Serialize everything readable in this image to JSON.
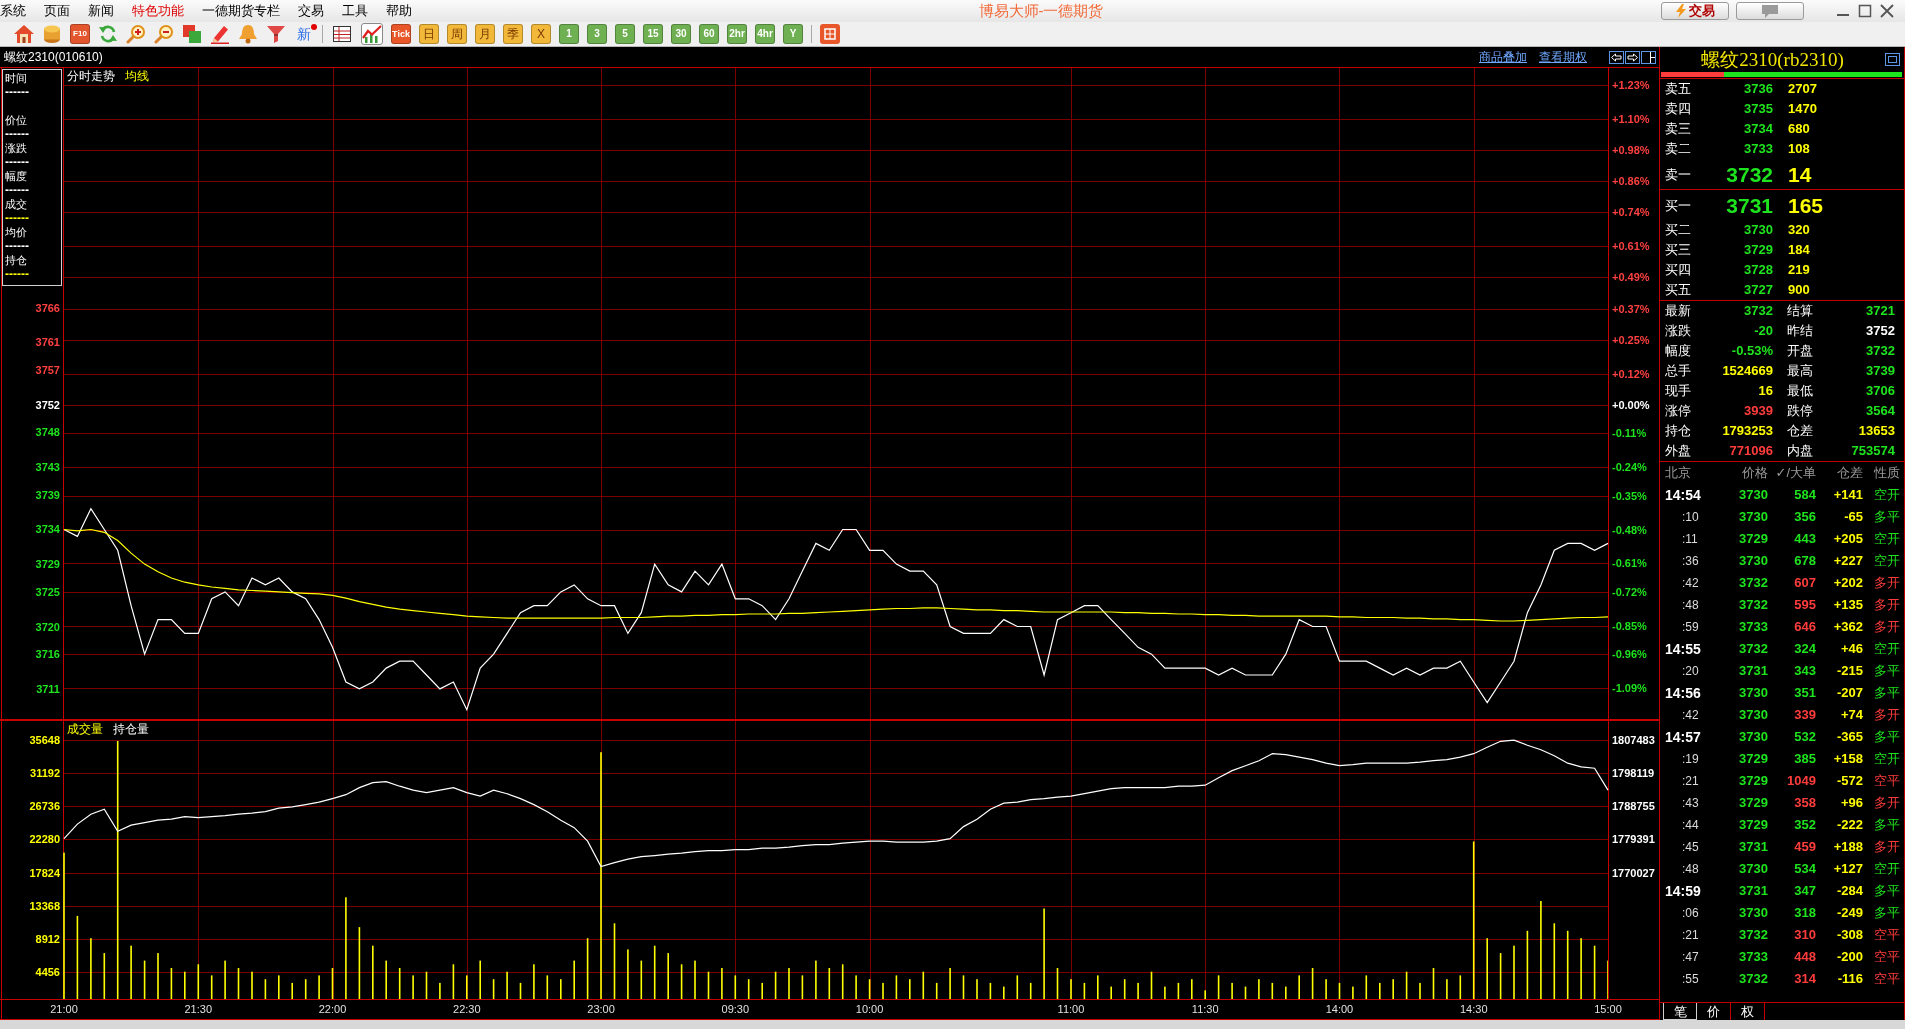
{
  "menu": [
    {
      "label": "系统",
      "emphasized": false
    },
    {
      "label": "页面",
      "emphasized": false
    },
    {
      "label": "新闻",
      "emphasized": false
    },
    {
      "label": "特色功能",
      "emphasized": true
    },
    {
      "label": "一德期货专栏",
      "emphasized": false
    },
    {
      "label": "交易",
      "emphasized": false
    },
    {
      "label": "工具",
      "emphasized": false
    },
    {
      "label": "帮助",
      "emphasized": false
    }
  ],
  "title": "博易大师-一德期货",
  "title_buttons": [
    {
      "kind": "trade",
      "label": "交易"
    },
    {
      "kind": "chat"
    }
  ],
  "tools": [
    {
      "kind": "home"
    },
    {
      "kind": "coins"
    },
    {
      "kind": "f10",
      "label": "F10"
    },
    {
      "kind": "refresh"
    },
    {
      "kind": "zoomin"
    },
    {
      "kind": "zoomout"
    },
    {
      "kind": "squares"
    },
    {
      "kind": "pencil"
    },
    {
      "kind": "bell"
    },
    {
      "kind": "filter"
    },
    {
      "kind": "news",
      "label": "新"
    }
  ],
  "views": [
    {
      "kind": "table",
      "selected": false
    },
    {
      "kind": "trend",
      "selected": true
    },
    {
      "kind": "tick",
      "label": "Tick",
      "selected": false
    },
    {
      "kind": "calendar",
      "label": "日",
      "selected": false
    },
    {
      "kind": "calendar",
      "label": "周",
      "selected": false
    },
    {
      "kind": "calendar",
      "label": "月",
      "selected": false
    },
    {
      "kind": "calendar",
      "label": "季",
      "selected": false
    },
    {
      "kind": "calendar",
      "label": "X",
      "selected": false
    },
    {
      "kind": "minute",
      "label": "1",
      "selected": false
    },
    {
      "kind": "minute",
      "label": "3",
      "selected": false
    },
    {
      "kind": "minute",
      "label": "5",
      "selected": false
    },
    {
      "kind": "minute",
      "label": "15",
      "selected": false
    },
    {
      "kind": "minute",
      "label": "30",
      "selected": false
    },
    {
      "kind": "minute",
      "label": "60",
      "selected": false
    },
    {
      "kind": "minute",
      "label": "2hr",
      "selected": false
    },
    {
      "kind": "minute",
      "label": "4hr",
      "selected": false
    },
    {
      "kind": "minute",
      "label": "Y",
      "selected": false
    }
  ],
  "chart_header": {
    "code": "螺纹2310(010610)",
    "links": [
      "商品叠加",
      "查看期权"
    ]
  },
  "info_box": [
    {
      "label": "时间",
      "value": "------",
      "color": "#ffffff"
    },
    {
      "label": "价位",
      "value": "------",
      "color": "#ffffff"
    },
    {
      "label": "涨跌",
      "value": "------",
      "color": "#ffffff"
    },
    {
      "label": "幅度",
      "value": "------",
      "color": "#ffffff"
    },
    {
      "label": "成交",
      "value": "------",
      "color": "#ffff00"
    },
    {
      "label": "均价",
      "value": "------",
      "color": "#ffffff"
    },
    {
      "label": "持仓",
      "value": "------",
      "color": "#ffff00"
    }
  ],
  "price_chart": {
    "chart_data": {
      "type": "line",
      "grid": true,
      "ylim": [
        3706.51,
        3800.74
      ],
      "yticks": [
        3766,
        3761,
        3757,
        3752,
        3748,
        3743,
        3739,
        3734,
        3729,
        3725,
        3720,
        3716,
        3711
      ],
      "y2lim": [
        -1.2124,
        1.299
      ],
      "y2ticks": [
        {
          "value": 1.23,
          "label": "+1.23%"
        },
        {
          "value": 1.1,
          "label": "+1.10%"
        },
        {
          "value": 0.98,
          "label": "+0.98%"
        },
        {
          "value": 0.86,
          "label": "+0.86%"
        },
        {
          "value": 0.74,
          "label": "+0.74%"
        },
        {
          "value": 0.61,
          "label": "+0.61%"
        },
        {
          "value": 0.49,
          "label": "+0.49%"
        },
        {
          "value": 0.37,
          "label": "+0.37%"
        },
        {
          "value": 0.25,
          "label": "+0.25%"
        },
        {
          "value": 0.12,
          "label": "+0.12%"
        },
        {
          "value": 0,
          "label": "+0.00%"
        },
        {
          "value": -0.11,
          "label": "-0.11%"
        },
        {
          "value": -0.24,
          "label": "-0.24%"
        },
        {
          "value": -0.35,
          "label": "-0.35%"
        },
        {
          "value": -0.48,
          "label": "-0.48%"
        },
        {
          "value": -0.61,
          "label": "-0.61%"
        },
        {
          "value": -0.72,
          "label": "-0.72%"
        },
        {
          "value": -0.85,
          "label": "-0.85%"
        },
        {
          "value": -0.96,
          "label": "-0.96%"
        },
        {
          "value": -1.09,
          "label": "-1.09%"
        }
      ],
      "categories": [
        null,
        null,
        null,
        null,
        null,
        null,
        null,
        null,
        null,
        null,
        null,
        null,
        null,
        null,
        null,
        null,
        null,
        null,
        null,
        null,
        null,
        null,
        null,
        null,
        null,
        null,
        null,
        null,
        null,
        null,
        null,
        null,
        null,
        null,
        null,
        null,
        null,
        null,
        null,
        null,
        null,
        null,
        null,
        null,
        null,
        null,
        null,
        null,
        null,
        null,
        null,
        null,
        null,
        null,
        null,
        null,
        null,
        null,
        null,
        null,
        null,
        null,
        null,
        null,
        null,
        null,
        null,
        null,
        null,
        null,
        null,
        null,
        null,
        null,
        null,
        null,
        null,
        null,
        null,
        null,
        null,
        null,
        null,
        null,
        null,
        null,
        null,
        null,
        null,
        null,
        null,
        null,
        null,
        null,
        null,
        null,
        null,
        null,
        null,
        null,
        null,
        null,
        null,
        null,
        null,
        null,
        null,
        null,
        null,
        null,
        null,
        null,
        null,
        null,
        null,
        null
      ],
      "series": [
        {
          "name": "分时走势",
          "color": "#ffffff",
          "values": [
            3734,
            3733,
            3737,
            3734,
            3731,
            3723,
            3716,
            3721,
            3721,
            3719,
            3719,
            3724,
            3725,
            3723,
            3727,
            3726,
            3727,
            3725,
            3724,
            3721,
            3717,
            3712,
            3711,
            3712,
            3714,
            3715,
            3715,
            3713,
            3711,
            3712,
            3708,
            3714,
            3716,
            3719,
            3722,
            3723,
            3723,
            3725,
            3726,
            3724,
            3723,
            3723,
            3719,
            3722,
            3729,
            3726,
            3725,
            3728,
            3726,
            3729,
            3724,
            3724,
            3723,
            3721,
            3724,
            3728,
            3732,
            3731,
            3734,
            3734,
            3731,
            3731,
            3729,
            3728,
            3728,
            3726,
            3720,
            3719,
            3719,
            3719,
            3721,
            3720,
            3720,
            3713,
            3721,
            3722,
            3723,
            3723,
            3721,
            3719,
            3717,
            3716,
            3714,
            3714,
            3714,
            3714,
            3713,
            3714,
            3713,
            3713,
            3713,
            3716,
            3721,
            3720,
            3720,
            3715,
            3715,
            3715,
            3714,
            3713,
            3714,
            3713,
            3714,
            3714,
            3715,
            3712,
            3709,
            3712,
            3715,
            3722,
            3726,
            3731,
            3732,
            3732,
            3731,
            3732
          ]
        },
        {
          "name": "均线",
          "color": "#ffff00",
          "values": [
            3734,
            3733.8,
            3734,
            3733.6,
            3732.4,
            3730.6,
            3729,
            3727.9,
            3727,
            3726.4,
            3726,
            3725.7,
            3725.5,
            3725.3,
            3725.2,
            3725.1,
            3725,
            3724.9,
            3724.8,
            3724.7,
            3724.5,
            3724.1,
            3723.6,
            3723.2,
            3722.8,
            3722.5,
            3722.3,
            3722.1,
            3721.9,
            3721.7,
            3721.5,
            3721.4,
            3721.3,
            3721.2,
            3721.2,
            3721.2,
            3721.2,
            3721.2,
            3721.2,
            3721.2,
            3721.2,
            3721.3,
            3721.3,
            3721.3,
            3721.4,
            3721.5,
            3721.5,
            3721.6,
            3721.6,
            3721.7,
            3721.7,
            3721.8,
            3721.8,
            3721.8,
            3721.9,
            3721.9,
            3722,
            3722.1,
            3722.2,
            3722.3,
            3722.4,
            3722.5,
            3722.6,
            3722.6,
            3722.7,
            3722.7,
            3722.6,
            3722.5,
            3722.4,
            3722.4,
            3722.3,
            3722.3,
            3722.2,
            3722.1,
            3722.1,
            3722.1,
            3722.1,
            3722.1,
            3722.1,
            3722,
            3722,
            3721.9,
            3721.9,
            3721.8,
            3721.8,
            3721.7,
            3721.7,
            3721.6,
            3721.6,
            3721.5,
            3721.5,
            3721.5,
            3721.5,
            3721.5,
            3721.5,
            3721.4,
            3721.4,
            3721.3,
            3721.3,
            3721.3,
            3721.2,
            3721.2,
            3721.1,
            3721.1,
            3721,
            3721,
            3720.9,
            3720.8,
            3720.8,
            3720.9,
            3721,
            3721.1,
            3721.2,
            3721.3,
            3721.3,
            3721.4
          ]
        }
      ]
    }
  },
  "volume_chart": {
    "chart_data": {
      "type": "bar",
      "grid": true,
      "ylim": [
        700,
        38320
      ],
      "yticks": [
        35648,
        31192,
        26736,
        22280,
        17824,
        13368,
        8912,
        4456
      ],
      "categories": [
        "21:00",
        null,
        null,
        null,
        null,
        null,
        null,
        null,
        null,
        null,
        "21:30",
        null,
        null,
        null,
        null,
        null,
        null,
        null,
        null,
        null,
        "22:00",
        null,
        null,
        null,
        null,
        null,
        null,
        null,
        null,
        null,
        "22:30",
        null,
        null,
        null,
        null,
        null,
        null,
        null,
        null,
        null,
        "23:00",
        null,
        null,
        null,
        null,
        null,
        null,
        null,
        null,
        null,
        "09:30",
        null,
        null,
        null,
        null,
        null,
        null,
        null,
        null,
        null,
        "10:00",
        null,
        null,
        null,
        null,
        null,
        null,
        null,
        null,
        null,
        null,
        null,
        null,
        null,
        null,
        "11:00",
        null,
        null,
        null,
        null,
        null,
        null,
        null,
        null,
        null,
        "11:30",
        null,
        null,
        null,
        null,
        null,
        null,
        null,
        null,
        null,
        "14:00",
        null,
        null,
        null,
        null,
        null,
        null,
        null,
        null,
        null,
        "14:30",
        null,
        null,
        null,
        null,
        null,
        null,
        null,
        null,
        null,
        "15:00"
      ],
      "series": [
        {
          "name": "成交量",
          "color": "#ffff00",
          "values": [
            20500,
            12000,
            9000,
            7000,
            35500,
            8000,
            6000,
            7000,
            5000,
            4500,
            5500,
            4000,
            6000,
            5000,
            4500,
            3500,
            4000,
            3000,
            3500,
            4000,
            5000,
            14500,
            10500,
            8000,
            6000,
            5000,
            4000,
            4500,
            3000,
            5500,
            4000,
            6000,
            3500,
            4500,
            3000,
            5500,
            4000,
            3500,
            6000,
            9000,
            34000,
            11000,
            7500,
            6000,
            8000,
            7000,
            5500,
            6000,
            4500,
            5000,
            4000,
            3500,
            3000,
            4500,
            5000,
            4000,
            6000,
            5000,
            5500,
            4000,
            3500,
            3000,
            4000,
            3500,
            4500,
            3000,
            5000,
            4000,
            3500,
            3000,
            2500,
            4000,
            3000,
            13000,
            5000,
            3500,
            3000,
            4000,
            2500,
            3500,
            3000,
            4500,
            2500,
            3000,
            3500,
            2000,
            4000,
            3000,
            2500,
            3500,
            3000,
            2500,
            4000,
            5000,
            3500,
            3000,
            2500,
            4000,
            3000,
            3500,
            4500,
            3000,
            5000,
            3500,
            4000,
            22000,
            9000,
            7000,
            8000,
            10000,
            14000,
            11000,
            10000,
            9000,
            8000,
            6000
          ]
        }
      ]
    }
  },
  "open_interest_chart": {
    "chart_data": {
      "type": "line",
      "ylim": [
        1734033,
        1813103
      ],
      "yticks": [
        1807483,
        1798119,
        1788755,
        1779391,
        1770027
      ],
      "categories": [
        null,
        null,
        null,
        null,
        null,
        null,
        null,
        null,
        null,
        null,
        null,
        null,
        null,
        null,
        null,
        null,
        null,
        null,
        null,
        null,
        null,
        null,
        null,
        null,
        null,
        null,
        null,
        null,
        null,
        null,
        null,
        null,
        null,
        null,
        null,
        null,
        null,
        null,
        null,
        null,
        null,
        null,
        null,
        null,
        null,
        null,
        null,
        null,
        null,
        null,
        null,
        null,
        null,
        null,
        null,
        null,
        null,
        null,
        null,
        null,
        null,
        null,
        null,
        null,
        null,
        null,
        null,
        null,
        null,
        null,
        null,
        null,
        null,
        null,
        null,
        null,
        null,
        null,
        null,
        null,
        null,
        null,
        null,
        null,
        null,
        null,
        null,
        null,
        null,
        null,
        null,
        null,
        null,
        null,
        null,
        null,
        null,
        null,
        null,
        null,
        null,
        null,
        null,
        null,
        null,
        null,
        null,
        null,
        null,
        null,
        null,
        null,
        null,
        null,
        null,
        null
      ],
      "series": [
        {
          "name": "持仓量",
          "color": "#ffffff",
          "values": [
            1779600,
            1783700,
            1786500,
            1787900,
            1781700,
            1783400,
            1784100,
            1784800,
            1785100,
            1785800,
            1785500,
            1785800,
            1786100,
            1786500,
            1786800,
            1787200,
            1788200,
            1788600,
            1789200,
            1789900,
            1790900,
            1792000,
            1794000,
            1795400,
            1795700,
            1794400,
            1793300,
            1792600,
            1793300,
            1794000,
            1792600,
            1791600,
            1793300,
            1792300,
            1790900,
            1789200,
            1787200,
            1784800,
            1782700,
            1778900,
            1771700,
            1772800,
            1773800,
            1774500,
            1774800,
            1775200,
            1775500,
            1775900,
            1776200,
            1776200,
            1776500,
            1776500,
            1776900,
            1776900,
            1777200,
            1777600,
            1777900,
            1777900,
            1778300,
            1778600,
            1778900,
            1778900,
            1778600,
            1778600,
            1778600,
            1778900,
            1779600,
            1783000,
            1785100,
            1787900,
            1789600,
            1789900,
            1790600,
            1790900,
            1791300,
            1791600,
            1792300,
            1793000,
            1793700,
            1794000,
            1794000,
            1794000,
            1794000,
            1794400,
            1794400,
            1794700,
            1796800,
            1798800,
            1800200,
            1801600,
            1803600,
            1803300,
            1802600,
            1801900,
            1800900,
            1800200,
            1800500,
            1800900,
            1800900,
            1800900,
            1800900,
            1801200,
            1801600,
            1801900,
            1802600,
            1803600,
            1805400,
            1807100,
            1807400,
            1806000,
            1804700,
            1803000,
            1800900,
            1799900,
            1799500,
            1793300
          ]
        }
      ]
    }
  },
  "quote": {
    "title": "螺纹2310(rb2310)",
    "ratio_bar": {
      "level": 0.26
    },
    "asks": [
      {
        "label": "卖五",
        "price": "3736",
        "volume": "2707",
        "kind": "level"
      },
      {
        "label": "卖四",
        "price": "3735",
        "volume": "1470",
        "kind": "level"
      },
      {
        "label": "卖三",
        "price": "3734",
        "volume": "680",
        "kind": "level"
      },
      {
        "label": "卖二",
        "price": "3733",
        "volume": "108",
        "kind": "level"
      },
      {
        "label": "卖一",
        "price": "3732",
        "volume": "14",
        "kind": "best"
      }
    ],
    "bids": [
      {
        "label": "买一",
        "price": "3731",
        "volume": "165",
        "kind": "best"
      },
      {
        "label": "买二",
        "price": "3730",
        "volume": "320",
        "kind": "level"
      },
      {
        "label": "买三",
        "price": "3729",
        "volume": "184",
        "kind": "level"
      },
      {
        "label": "买四",
        "price": "3728",
        "volume": "219",
        "kind": "level"
      },
      {
        "label": "买五",
        "price": "3727",
        "volume": "900",
        "kind": "level"
      }
    ],
    "stats": [
      {
        "label": "最新",
        "value": "3732",
        "color": "#1ee41e"
      },
      {
        "label": "结算",
        "value": "3721",
        "color": "#1ee41e"
      },
      {
        "label": "涨跌",
        "value": "-20",
        "color": "#1ee41e"
      },
      {
        "label": "昨结",
        "value": "3752",
        "color": "#ffffff"
      },
      {
        "label": "幅度",
        "value": "-0.53%",
        "color": "#1ee41e"
      },
      {
        "label": "开盘",
        "value": "3732",
        "color": "#1ee41e"
      },
      {
        "label": "总手",
        "value": "1524669",
        "color": "#ffff00"
      },
      {
        "label": "最高",
        "value": "3739",
        "color": "#1ee41e"
      },
      {
        "label": "现手",
        "value": "16",
        "color": "#ffff00"
      },
      {
        "label": "最低",
        "value": "3706",
        "color": "#1ee41e"
      },
      {
        "label": "涨停",
        "value": "3939",
        "color": "#ff3c3c"
      },
      {
        "label": "跌停",
        "value": "3564",
        "color": "#1ee41e"
      },
      {
        "label": "持仓",
        "value": "1793253",
        "color": "#ffff00"
      },
      {
        "label": "仓差",
        "value": "13653",
        "color": "#ffff00"
      },
      {
        "label": "外盘",
        "value": "771096",
        "color": "#ff3c3c"
      },
      {
        "label": "内盘",
        "value": "753574",
        "color": "#1ee41e"
      }
    ]
  },
  "trades": {
    "columns": [
      "北京",
      "价格",
      "✓/大单",
      "仓差",
      "性质"
    ],
    "rows": [
      {
        "time": "14:54",
        "kind": "minute",
        "price": "3730",
        "volume": "584",
        "oi_change": "+141",
        "nature": "空开",
        "color": "#1ee41e"
      },
      {
        "time": ":10",
        "kind": "second",
        "price": "3730",
        "volume": "356",
        "oi_change": "-65",
        "nature": "多平",
        "color": "#1ee41e"
      },
      {
        "time": ":11",
        "kind": "second",
        "price": "3729",
        "volume": "443",
        "oi_change": "+205",
        "nature": "空开",
        "color": "#1ee41e"
      },
      {
        "time": ":36",
        "kind": "second",
        "price": "3730",
        "volume": "678",
        "oi_change": "+227",
        "nature": "空开",
        "color": "#1ee41e"
      },
      {
        "time": ":42",
        "kind": "second",
        "price": "3732",
        "volume": "607",
        "oi_change": "+202",
        "nature": "多开",
        "color": "#ff3c3c"
      },
      {
        "time": ":48",
        "kind": "second",
        "price": "3732",
        "volume": "595",
        "oi_change": "+135",
        "nature": "多开",
        "color": "#ff3c3c"
      },
      {
        "time": ":59",
        "kind": "second",
        "price": "3733",
        "volume": "646",
        "oi_change": "+362",
        "nature": "多开",
        "color": "#ff3c3c"
      },
      {
        "time": "14:55",
        "kind": "minute",
        "price": "3732",
        "volume": "324",
        "oi_change": "+46",
        "nature": "空开",
        "color": "#1ee41e"
      },
      {
        "time": ":20",
        "kind": "second",
        "price": "3731",
        "volume": "343",
        "oi_change": "-215",
        "nature": "多平",
        "color": "#1ee41e"
      },
      {
        "time": "14:56",
        "kind": "minute",
        "price": "3730",
        "volume": "351",
        "oi_change": "-207",
        "nature": "多平",
        "color": "#1ee41e"
      },
      {
        "time": ":42",
        "kind": "second",
        "price": "3730",
        "volume": "339",
        "oi_change": "+74",
        "nature": "多开",
        "color": "#ff3c3c"
      },
      {
        "time": "14:57",
        "kind": "minute",
        "price": "3730",
        "volume": "532",
        "oi_change": "-365",
        "nature": "多平",
        "color": "#1ee41e"
      },
      {
        "time": ":19",
        "kind": "second",
        "price": "3729",
        "volume": "385",
        "oi_change": "+158",
        "nature": "空开",
        "color": "#1ee41e"
      },
      {
        "time": ":21",
        "kind": "second",
        "price": "3729",
        "volume": "1049",
        "oi_change": "-572",
        "nature": "空平",
        "color": "#ff3c3c"
      },
      {
        "time": ":43",
        "kind": "second",
        "price": "3729",
        "volume": "358",
        "oi_change": "+96",
        "nature": "多开",
        "color": "#ff3c3c"
      },
      {
        "time": ":44",
        "kind": "second",
        "price": "3729",
        "volume": "352",
        "oi_change": "-222",
        "nature": "多平",
        "color": "#1ee41e"
      },
      {
        "time": ":45",
        "kind": "second",
        "price": "3731",
        "volume": "459",
        "oi_change": "+188",
        "nature": "多开",
        "color": "#ff3c3c"
      },
      {
        "time": ":48",
        "kind": "second",
        "price": "3730",
        "volume": "534",
        "oi_change": "+127",
        "nature": "空开",
        "color": "#1ee41e"
      },
      {
        "time": "14:59",
        "kind": "minute",
        "price": "3731",
        "volume": "347",
        "oi_change": "-284",
        "nature": "多平",
        "color": "#1ee41e"
      },
      {
        "time": ":06",
        "kind": "second",
        "price": "3730",
        "volume": "318",
        "oi_change": "-249",
        "nature": "多平",
        "color": "#1ee41e"
      },
      {
        "time": ":21",
        "kind": "second",
        "price": "3732",
        "volume": "310",
        "oi_change": "-308",
        "nature": "空平",
        "color": "#ff3c3c"
      },
      {
        "time": ":47",
        "kind": "second",
        "price": "3733",
        "volume": "448",
        "oi_change": "-200",
        "nature": "空平",
        "color": "#ff3c3c"
      },
      {
        "time": ":55",
        "kind": "second",
        "price": "3732",
        "volume": "314",
        "oi_change": "-116",
        "nature": "空平",
        "color": "#ff3c3c"
      }
    ]
  },
  "tabs": [
    {
      "label": "笔",
      "selected": true
    },
    {
      "label": "价",
      "selected": false
    },
    {
      "label": "权",
      "selected": false
    }
  ]
}
